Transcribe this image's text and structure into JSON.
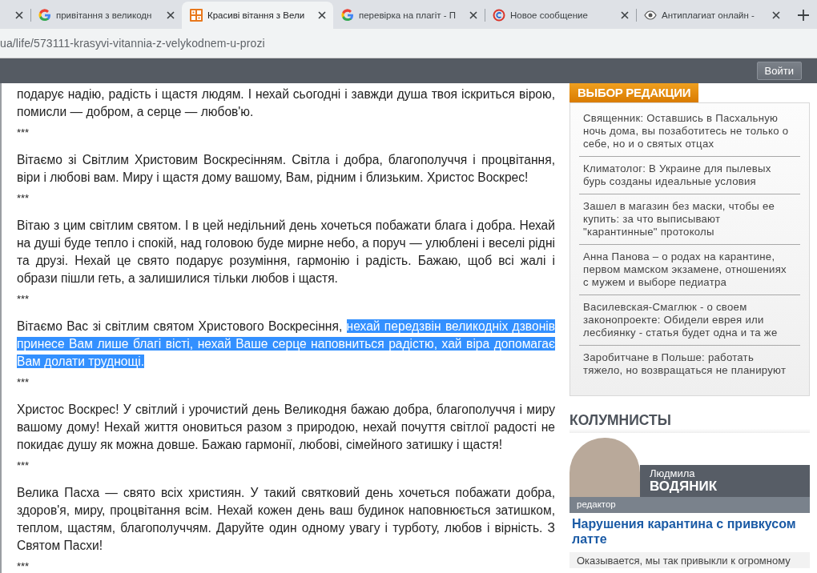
{
  "browser": {
    "tabs": [
      {
        "selected": false
      },
      {
        "label": "привітання з великодн",
        "selected": false
      },
      {
        "label": "Красиві вітання з Вели",
        "selected": true
      },
      {
        "label": "перевірка на плагіт - П",
        "selected": false
      },
      {
        "label": "Новое сообщение",
        "selected": false
      },
      {
        "label": "Антиплагиат онлайн -",
        "selected": false
      }
    ],
    "address": "ua/life/573111-krasyvi-vitannia-z-velykodnem-u-prozi"
  },
  "header": {
    "login_button": "Войти"
  },
  "article": [
    {
      "kind": "text",
      "parts": [
        {
          "text": "подарує надію, радість і щастя людям. І нехай сьогодні і завжди душа твоя іскриться вірою, помисли — добром, а серце — любов'ю.",
          "selected": false
        }
      ]
    },
    {
      "kind": "separator",
      "text": "***"
    },
    {
      "kind": "text",
      "parts": [
        {
          "text": "Вітаємо зі Світлим Христовим Воскресінням. Світла і добра, благополуччя і процвітання, віри і любові вам. Миру і щастя дому вашому, Вам, рідним і близьким. Христос Воскрес!",
          "selected": false
        }
      ]
    },
    {
      "kind": "separator",
      "text": "***"
    },
    {
      "kind": "text",
      "parts": [
        {
          "text": "Вітаю з цим світлим святом. І в цей недільний день хочеться побажати блага і добра. Нехай на душі буде тепло і спокій, над головою буде мирне небо, а поруч — улюблені і веселі рідні та друзі. Нехай це свято подарує розуміння, гармонію і радість. Бажаю, щоб всі жалі і образи пішли геть, а залишилися тільки любов і щастя.",
          "selected": false
        }
      ]
    },
    {
      "kind": "separator",
      "text": "***"
    },
    {
      "kind": "text",
      "parts": [
        {
          "text": "Вітаємо Вас зі світлим святом Христового Воскресіння, ",
          "selected": false
        },
        {
          "text": "нехай передзвін великодніх дзвонів",
          "selected": true
        },
        {
          "text": "принесе Вам лише благі вісті, нехай Ваше серце наповниться радістю, хай віра допомагає",
          "selected": true
        },
        {
          "text": "Вам долати труднощі.",
          "selected": true
        }
      ]
    },
    {
      "kind": "separator",
      "text": "***"
    },
    {
      "kind": "text",
      "parts": [
        {
          "text": "Христос Воскрес! У світлий і урочистий день Великодня бажаю добра, благополуччя і миру вашому дому! Нехай життя оновиться разом з природою, нехай почуття світлої радості не покидає душу як можна довше. Бажаю гармонії, любові, сімейного затишку і щастя!",
          "selected": false
        }
      ]
    },
    {
      "kind": "separator",
      "text": "***"
    },
    {
      "kind": "text",
      "parts": [
        {
          "text": "Велика Пасха — свято всіх християн. У такий святковий день хочеться побажати добра, здоров'я, миру, процвітання всім. Нехай кожен день ваш будинок наповнюється затишком, теплом, щастям, благополуччям. Даруйте один одному увагу і турботу, любов і вірність. З Святом Пасхи!",
          "selected": false
        }
      ]
    },
    {
      "kind": "separator",
      "text": "***"
    }
  ],
  "editors_choice": {
    "title": "ВЫБОР РЕДАКЦИИ",
    "items": [
      "Священник: Оставшись в Пасхальную ночь дома, вы позаботитесь не только о себе, но и о святых отцах",
      "Климатолог: В Украине для пылевых бурь созданы идеальные условия",
      "Зашел в магазин без маски, чтобы ее купить: за что выписывают \"карантинные\" протоколы",
      "Анна Панова – о родах на карантине, первом мамском экзамене, отношениях с мужем и выборе педиатра",
      "Василевская-Смаглюк - о своем законопроекте: Обидели еврея или лесбиянку - статья будет одна и та же",
      "Заробитчане в Польше: работать тяжело, но возвращаться не планируют"
    ]
  },
  "columnists": {
    "title": "КОЛУМНИСТЫ",
    "first_name": "Людмила",
    "last_name": "ВОДЯНИК",
    "role": "редактор",
    "headline": "Нарушения карантина с привкусом латте",
    "excerpt": "Оказывается, мы так привыкли к огромному"
  }
}
